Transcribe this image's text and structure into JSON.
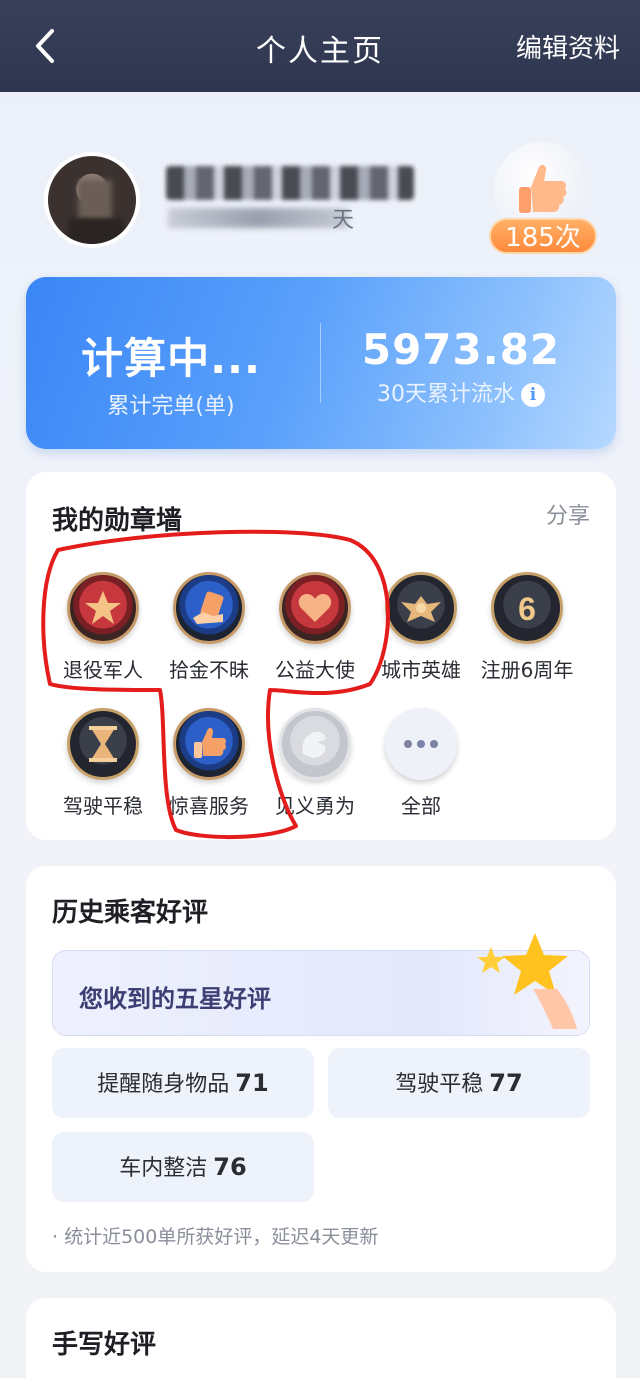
{
  "header": {
    "title": "个人主页",
    "edit_label": "编辑资料"
  },
  "profile": {
    "subtitle_suffix": "天",
    "like_count": "185次"
  },
  "stats": {
    "orders_value": "计算中...",
    "orders_label": "累计完单(单)",
    "revenue_value": "5973.82",
    "revenue_label": "30天累计流水",
    "info_symbol": "i"
  },
  "badges": {
    "title": "我的勋章墙",
    "share_label": "分享",
    "items": [
      {
        "label": "退役军人",
        "icon": "star-medal-icon"
      },
      {
        "label": "拾金不昧",
        "icon": "card-hand-medal-icon"
      },
      {
        "label": "公益大使",
        "icon": "heart-medal-icon"
      },
      {
        "label": "城市英雄",
        "icon": "wings-medal-icon"
      },
      {
        "label": "注册6周年",
        "icon": "six-year-medal-icon"
      },
      {
        "label": "驾驶平稳",
        "icon": "hourglass-medal-icon"
      },
      {
        "label": "惊喜服务",
        "icon": "thumbs-up-medal-icon"
      },
      {
        "label": "见义勇为",
        "icon": "hand-medal-icon"
      },
      {
        "label": "全部",
        "icon": "more-icon"
      }
    ]
  },
  "reviews": {
    "title": "历史乘客好评",
    "five_star_label": "您收到的五星好评",
    "tags": [
      {
        "label": "提醒随身物品",
        "count": "71"
      },
      {
        "label": "驾驶平稳",
        "count": "77"
      },
      {
        "label": "车内整洁",
        "count": "76"
      }
    ],
    "note": "· 统计近500单所获好评，延迟4天更新"
  },
  "handwritten": {
    "title": "手写好评"
  },
  "colors": {
    "header_bg": "#2f3650",
    "stats_blue": "#3a86f6",
    "orange_badge": "#ff8a3c",
    "annotation_red": "#e51c1c"
  }
}
